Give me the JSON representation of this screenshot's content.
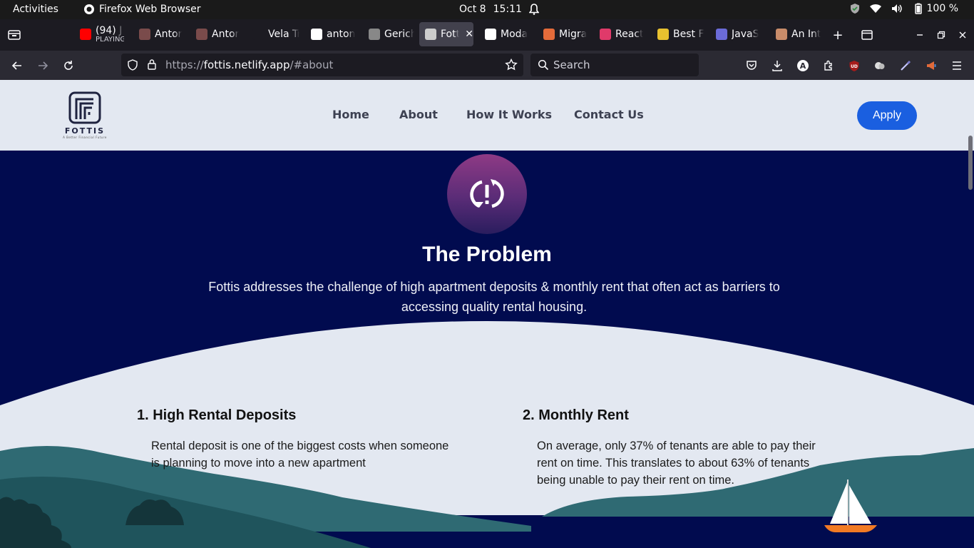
{
  "system_bar": {
    "activities": "Activities",
    "app_name": "Firefox Web Browser",
    "date": "Oct 8",
    "time": "15:11",
    "battery": "100 %"
  },
  "tabs": [
    {
      "title": "(94) J",
      "subtitle": "PLAYING",
      "icon": "youtube-icon",
      "color": "#ff0000"
    },
    {
      "title": "Antor",
      "icon": "avatar-icon",
      "color": "#7a4b4b"
    },
    {
      "title": "Antor",
      "icon": "avatar-icon",
      "color": "#7a4b4b"
    },
    {
      "title": "Vela Trus",
      "icon": "blank-icon",
      "color": "#1c1b22"
    },
    {
      "title": "anton",
      "icon": "github-icon",
      "color": "#ffffff"
    },
    {
      "title": "Gerich",
      "icon": "dash-icon",
      "color": "#888888"
    },
    {
      "title": "Fottis",
      "icon": "fottis-icon",
      "color": "#cccccc",
      "active": true
    },
    {
      "title": "Moda",
      "icon": "openai-icon",
      "color": "#ffffff"
    },
    {
      "title": "Migra",
      "icon": "asterisk-icon",
      "color": "#e46b3a"
    },
    {
      "title": "React",
      "icon": "react-icon",
      "color": "#e03a6a"
    },
    {
      "title": "Best F",
      "icon": "dev-icon",
      "color": "#e8c12f"
    },
    {
      "title": "JavaS",
      "icon": "mdn-icon",
      "color": "#6b6bd8"
    },
    {
      "title": "An Int",
      "icon": "avatar-icon",
      "color": "#c98c6a"
    }
  ],
  "address_bar": {
    "url_prefix": "https://",
    "url_host": "fottis.netlify.app",
    "url_path": "/#about",
    "search_placeholder": "Search"
  },
  "site": {
    "logo_word": "FOTTIS",
    "logo_tagline": "A Better Financial Future",
    "nav": [
      "Home",
      "About",
      "How It Works",
      "Contact Us"
    ],
    "apply_label": "Apply",
    "problem_title": "The Problem",
    "problem_desc": "Fottis addresses the challenge of high apartment deposits & monthly rent that often act as barriers to accessing quality rental housing.",
    "cards": [
      {
        "title": "1. High Rental Deposits",
        "body": "Rental deposit is one of the biggest costs when someone is planning to move into a new apartment"
      },
      {
        "title": "2. Monthly Rent",
        "body": "On average, only 37% of tenants are able to pay their rent on time. This translates to about 63% of tenants being unable to pay their rent on time."
      }
    ]
  },
  "colors": {
    "navy": "#010b4f",
    "header_bg": "#e3e8f1",
    "apply_blue": "#1a5fe0",
    "teal": "#2f6a73"
  }
}
